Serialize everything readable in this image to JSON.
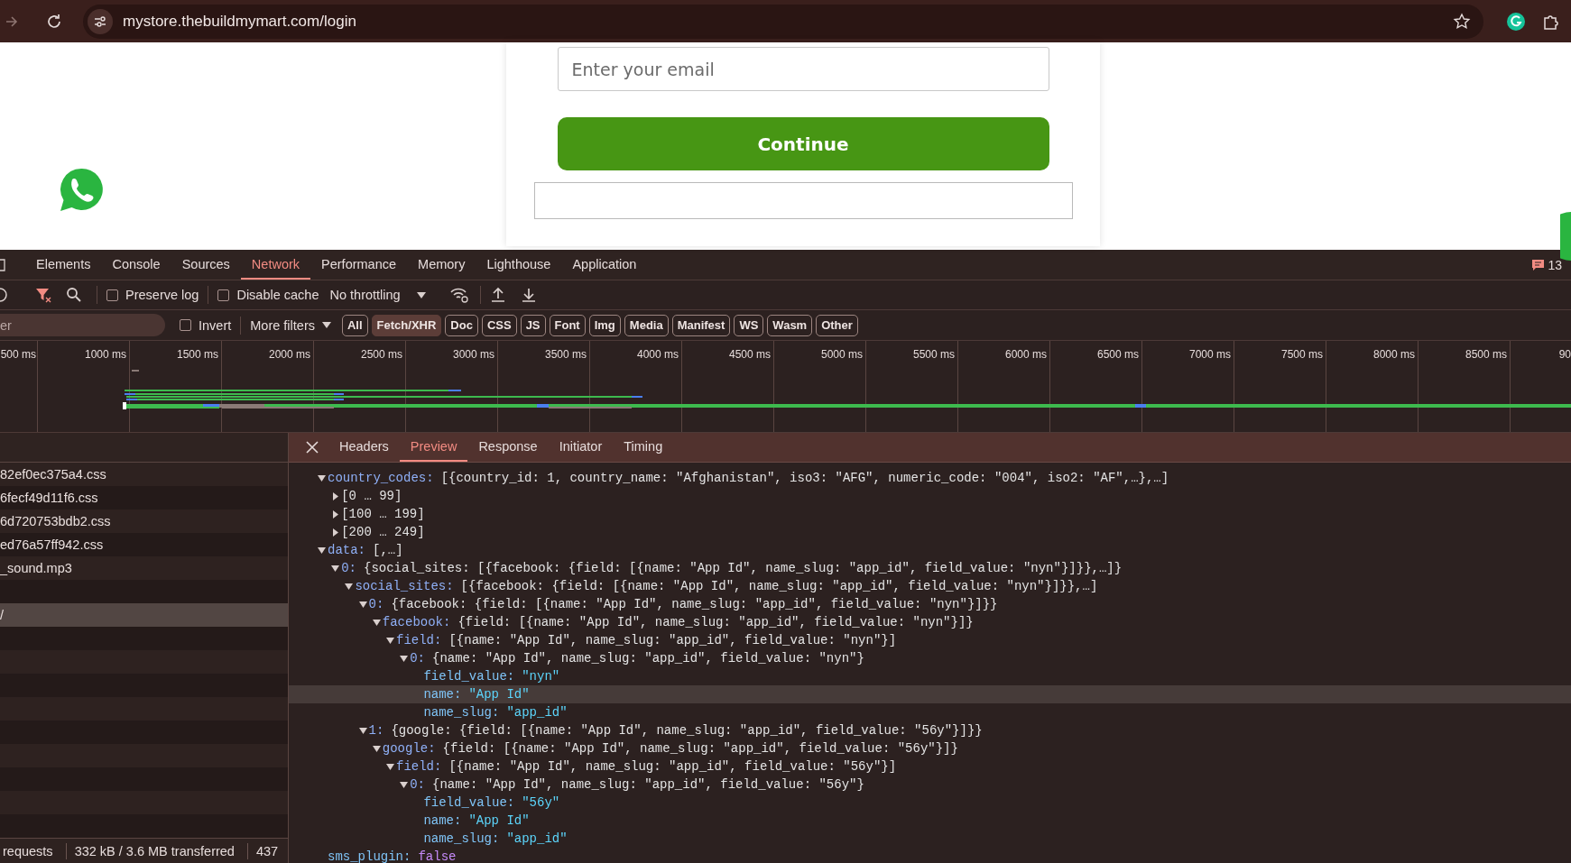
{
  "browser": {
    "url": "mystore.thebuildmymart.com/login"
  },
  "page": {
    "email_field": {
      "placeholder": "Enter your email"
    },
    "continue_button": "Continue"
  },
  "devtools": {
    "tabs": [
      {
        "label": "Elements",
        "selected": false
      },
      {
        "label": "Console",
        "selected": false
      },
      {
        "label": "Sources",
        "selected": false
      },
      {
        "label": "Network",
        "selected": true
      },
      {
        "label": "Performance",
        "selected": false
      },
      {
        "label": "Memory",
        "selected": false
      },
      {
        "label": "Lighthouse",
        "selected": false
      },
      {
        "label": "Application",
        "selected": false
      }
    ],
    "issues_count": "13",
    "toolbar": {
      "preserve_log": {
        "label": "Preserve log",
        "checked": false
      },
      "disable_cache": {
        "label": "Disable cache",
        "checked": false
      },
      "throttling": "No throttling"
    },
    "filter": {
      "placeholder": "er",
      "invert": {
        "label": "Invert",
        "checked": false
      },
      "more_filters": "More filters",
      "types": [
        {
          "label": "All",
          "selected": false
        },
        {
          "label": "Fetch/XHR",
          "selected": true
        },
        {
          "label": "Doc",
          "selected": false
        },
        {
          "label": "CSS",
          "selected": false
        },
        {
          "label": "JS",
          "selected": false
        },
        {
          "label": "Font",
          "selected": false
        },
        {
          "label": "Img",
          "selected": false
        },
        {
          "label": "Media",
          "selected": false
        },
        {
          "label": "Manifest",
          "selected": false
        },
        {
          "label": "WS",
          "selected": false
        },
        {
          "label": "Wasm",
          "selected": false
        },
        {
          "label": "Other",
          "selected": false
        }
      ]
    },
    "timeline": {
      "ticks": [
        "500 ms",
        "1000 ms",
        "1500 ms",
        "2000 ms",
        "2500 ms",
        "3000 ms",
        "3500 ms",
        "4000 ms",
        "4500 ms",
        "5000 ms",
        "5500 ms",
        "6000 ms",
        "6500 ms",
        "7000 ms",
        "7500 ms",
        "8000 ms",
        "8500 ms",
        "90"
      ]
    },
    "requests": [
      {
        "name": "82ef0ec375a4.css",
        "selected": false
      },
      {
        "name": "6fecf49d11f6.css",
        "selected": false
      },
      {
        "name": "6d720753bdb2.css",
        "selected": false
      },
      {
        "name": "ed76a57ff942.css",
        "selected": false
      },
      {
        "name": "_sound.mp3",
        "selected": false
      },
      {
        "selected": false
      },
      {
        "name": "/",
        "selected": true
      }
    ],
    "status_bar": [
      "requests",
      "332 kB / 3.6 MB transferred",
      "437"
    ],
    "detail_tabs": [
      {
        "label": "Headers",
        "selected": false
      },
      {
        "label": "Preview",
        "selected": true
      },
      {
        "label": "Response",
        "selected": false
      },
      {
        "label": "Initiator",
        "selected": false
      },
      {
        "label": "Timing",
        "selected": false
      }
    ],
    "preview": [
      {
        "key": "country_codes:",
        "value": "[{country_id: 1, country_name: \"Afghanistan\", iso3: \"AFG\", numeric_code: \"004\", iso2: \"AF\",…},…]",
        "kind": "object",
        "expanded": true,
        "selected": false,
        "children": [
          {
            "key": "[0 … 99]",
            "kind": "range",
            "expanded": false,
            "selected": false
          },
          {
            "key": "[100 … 199]",
            "kind": "range",
            "expanded": false,
            "selected": false
          },
          {
            "key": "[200 … 249]",
            "kind": "range",
            "expanded": false,
            "selected": false
          }
        ]
      },
      {
        "key": "data:",
        "value": "[,…]",
        "kind": "object",
        "expanded": true,
        "selected": false,
        "children": [
          {
            "key": "0:",
            "value": "{social_sites: [{facebook: {field: [{name: \"App Id\", name_slug: \"app_id\", field_value: \"nyn\"}]}},…]}",
            "kind": "object",
            "expanded": true,
            "selected": false,
            "children": [
              {
                "key": "social_sites:",
                "value": "[{facebook: {field: [{name: \"App Id\", name_slug: \"app_id\", field_value: \"nyn\"}]}},…]",
                "kind": "object",
                "expanded": true,
                "selected": false,
                "children": [
                  {
                    "key": "0:",
                    "value": "{facebook: {field: [{name: \"App Id\", name_slug: \"app_id\", field_value: \"nyn\"}]}}",
                    "kind": "object",
                    "expanded": true,
                    "selected": false,
                    "children": [
                      {
                        "key": "facebook:",
                        "value": "{field: [{name: \"App Id\", name_slug: \"app_id\", field_value: \"nyn\"}]}",
                        "kind": "object",
                        "expanded": true,
                        "selected": false,
                        "children": [
                          {
                            "key": "field:",
                            "value": "[{name: \"App Id\", name_slug: \"app_id\", field_value: \"nyn\"}]",
                            "kind": "object",
                            "expanded": true,
                            "selected": false,
                            "children": [
                              {
                                "key": "0:",
                                "value": "{name: \"App Id\", name_slug: \"app_id\", field_value: \"nyn\"}",
                                "kind": "object",
                                "expanded": true,
                                "selected": false,
                                "children": [
                                  {
                                    "key": "field_value:",
                                    "value": "\"nyn\"",
                                    "kind": "string",
                                    "selected": false
                                  },
                                  {
                                    "key": "name:",
                                    "value": "\"App Id\"",
                                    "kind": "string",
                                    "selected": true
                                  },
                                  {
                                    "key": "name_slug:",
                                    "value": "\"app_id\"",
                                    "kind": "string",
                                    "selected": false
                                  }
                                ]
                              }
                            ]
                          }
                        ]
                      }
                    ]
                  },
                  {
                    "key": "1:",
                    "value": "{google: {field: [{name: \"App Id\", name_slug: \"app_id\", field_value: \"56y\"}]}}",
                    "kind": "object",
                    "expanded": true,
                    "selected": false,
                    "children": [
                      {
                        "key": "google:",
                        "value": "{field: [{name: \"App Id\", name_slug: \"app_id\", field_value: \"56y\"}]}",
                        "kind": "object",
                        "expanded": true,
                        "selected": false,
                        "children": [
                          {
                            "key": "field:",
                            "value": "[{name: \"App Id\", name_slug: \"app_id\", field_value: \"56y\"}]",
                            "kind": "object",
                            "expanded": true,
                            "selected": false,
                            "children": [
                              {
                                "key": "0:",
                                "value": "{name: \"App Id\", name_slug: \"app_id\", field_value: \"56y\"}",
                                "kind": "object",
                                "expanded": true,
                                "selected": false,
                                "children": [
                                  {
                                    "key": "field_value:",
                                    "value": "\"56y\"",
                                    "kind": "string",
                                    "selected": false
                                  },
                                  {
                                    "key": "name:",
                                    "value": "\"App Id\"",
                                    "kind": "string",
                                    "selected": false
                                  },
                                  {
                                    "key": "name_slug:",
                                    "value": "\"app_id\"",
                                    "kind": "string",
                                    "selected": false
                                  }
                                ]
                              }
                            ]
                          }
                        ]
                      }
                    ]
                  }
                ]
              }
            ]
          }
        ]
      },
      {
        "key": "sms_plugin:",
        "value": "false",
        "kind": "boolean",
        "selected": false
      }
    ]
  }
}
